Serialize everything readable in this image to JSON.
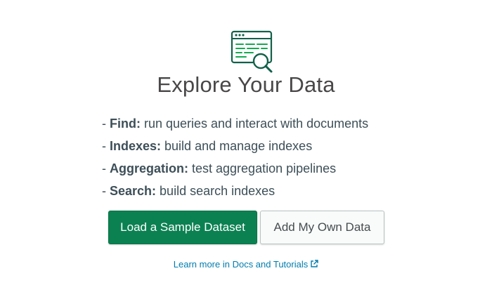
{
  "illustration": {
    "icon": "explore-data-icon",
    "colors": {
      "primary": "#116149",
      "accent": "#13aa52"
    }
  },
  "title": "Explore Your Data",
  "features": [
    {
      "prefix": "- ",
      "name": "Find:",
      "description": " run queries and interact with documents"
    },
    {
      "prefix": "- ",
      "name": "Indexes:",
      "description": " build and manage indexes"
    },
    {
      "prefix": "- ",
      "name": "Aggregation:",
      "description": " test aggregation pipelines"
    },
    {
      "prefix": "- ",
      "name": "Search:",
      "description": " build search indexes"
    }
  ],
  "buttons": {
    "load_sample": "Load a Sample Dataset",
    "add_own": "Add My Own Data"
  },
  "learn_more": {
    "label": "Learn more in Docs and Tutorials",
    "icon": "external-link-icon"
  },
  "colors": {
    "primary_button": "#0b8152",
    "link": "#007cad",
    "text": "#3d4f58"
  }
}
